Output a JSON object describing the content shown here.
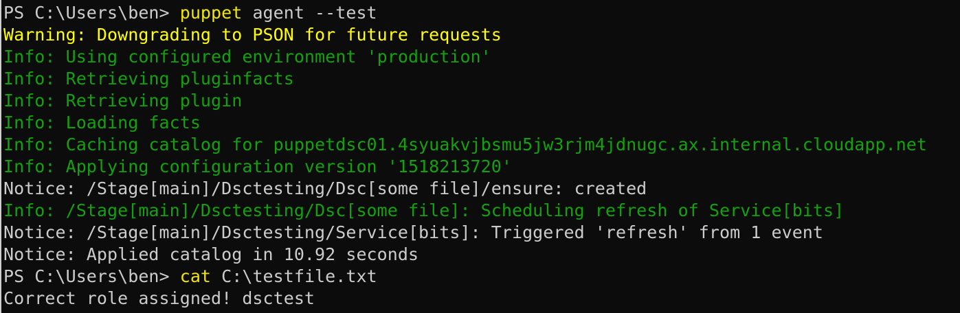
{
  "terminal": {
    "lines": [
      {
        "type": "prompt",
        "prompt": "PS C:\\Users\\ben> ",
        "command": "puppet",
        "args": " agent --test"
      },
      {
        "type": "warning",
        "text": "Warning: Downgrading to PSON for future requests"
      },
      {
        "type": "info",
        "text": "Info: Using configured environment 'production'"
      },
      {
        "type": "info",
        "text": "Info: Retrieving pluginfacts"
      },
      {
        "type": "info",
        "text": "Info: Retrieving plugin"
      },
      {
        "type": "info",
        "text": "Info: Loading facts"
      },
      {
        "type": "info",
        "text": "Info: Caching catalog for puppetdsc01.4syuakvjbsmu5jw3rjm4jdnugc.ax.internal.cloudapp.net"
      },
      {
        "type": "info",
        "text": "Info: Applying configuration version '1518213720'"
      },
      {
        "type": "notice",
        "text": "Notice: /Stage[main]/Dsctesting/Dsc[some file]/ensure: created"
      },
      {
        "type": "info",
        "text": "Info: /Stage[main]/Dsctesting/Dsc[some file]: Scheduling refresh of Service[bits]"
      },
      {
        "type": "notice",
        "text": "Notice: /Stage[main]/Dsctesting/Service[bits]: Triggered 'refresh' from 1 event"
      },
      {
        "type": "notice",
        "text": "Notice: Applied catalog in 10.92 seconds"
      },
      {
        "type": "prompt",
        "prompt": "PS C:\\Users\\ben> ",
        "command": "cat",
        "args": " C:\\testfile.txt"
      },
      {
        "type": "output",
        "text": "Correct role assigned! dsctest"
      }
    ]
  },
  "colors": {
    "background": "#0c0c0c",
    "default_text": "#cccccc",
    "command": "#f0e600",
    "warning": "#ffff00",
    "info": "#13a10e"
  }
}
